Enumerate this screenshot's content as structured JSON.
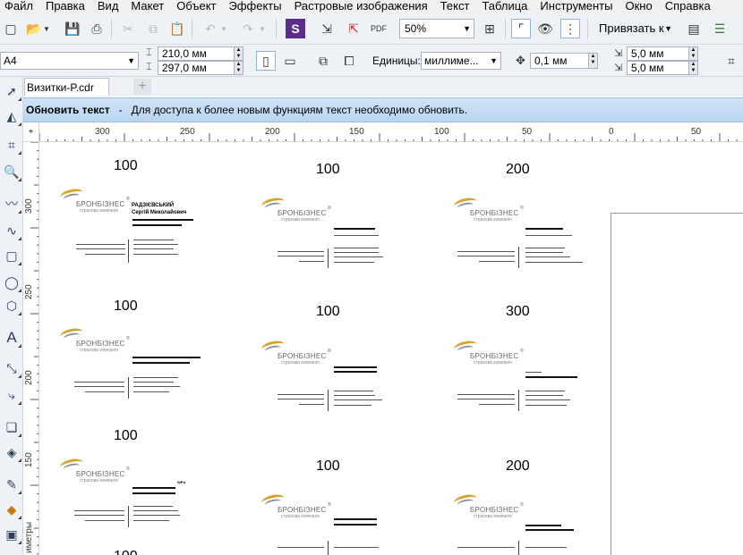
{
  "menu": [
    "Файл",
    "Правка",
    "Вид",
    "Макет",
    "Объект",
    "Эффекты",
    "Растровые изображения",
    "Текст",
    "Таблица",
    "Инструменты",
    "Окно",
    "Справка"
  ],
  "toolbar": {
    "zoom_value": "50%",
    "snap_label": "Привязать к"
  },
  "property_bar": {
    "paper_size": "A4",
    "width": "210,0 мм",
    "height": "297,0 мм",
    "units_label": "Единицы:",
    "units_value": "миллиме...",
    "nudge": "0,1 мм",
    "dup_x": "5,0 мм",
    "dup_y": "5,0 мм"
  },
  "document_tab": "Визитки-P.cdr",
  "notification": {
    "title": "Обновить текст",
    "separator": "-",
    "message": "Для доступа к более новым функциям текст необходимо обновить."
  },
  "hruler_labels": [
    "300",
    "250",
    "200",
    "150",
    "100",
    "50",
    "0",
    "50"
  ],
  "vruler_labels": [
    "300",
    "250",
    "200",
    "150"
  ],
  "vruler_unit": "иметры",
  "cards": [
    {
      "label": "100",
      "name_line1": "РАДЗІЄВСЬКИЙ",
      "name_line2": "Сергій Миколайович"
    },
    {
      "label": "100"
    },
    {
      "label": "200"
    },
    {
      "label": "100"
    },
    {
      "label": "100"
    },
    {
      "label": "300"
    },
    {
      "label": "100",
      "tiny": "WPd"
    },
    {
      "label": "100"
    },
    {
      "label": "200"
    },
    {
      "label": "100"
    }
  ],
  "logo": {
    "brand": "БРОНБІЗНЕС",
    "reg": "®",
    "subtitle": "страхова компанія"
  }
}
